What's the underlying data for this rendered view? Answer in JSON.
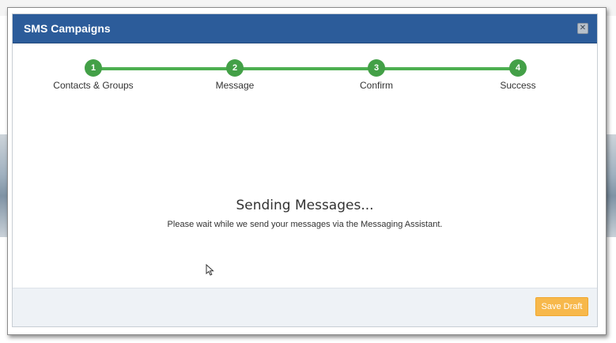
{
  "modal": {
    "title": "SMS Campaigns",
    "close_icon": "close-icon"
  },
  "stepper": {
    "steps": [
      {
        "number": "1",
        "label": "Contacts & Groups"
      },
      {
        "number": "2",
        "label": "Message"
      },
      {
        "number": "3",
        "label": "Confirm"
      },
      {
        "number": "4",
        "label": "Success"
      }
    ],
    "color": "#43a047"
  },
  "status": {
    "title": "Sending Messages...",
    "subtitle": "Please wait while we send your messages via the Messaging Assistant."
  },
  "footer": {
    "save_draft_label": "Save Draft"
  },
  "colors": {
    "header": "#2c5c9a",
    "save_button": "#f7b84b",
    "footer_bg": "#eef2f6"
  }
}
